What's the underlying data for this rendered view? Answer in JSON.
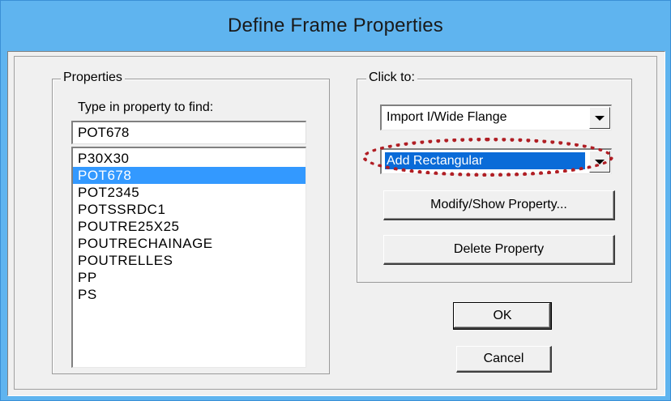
{
  "window": {
    "title": "Define Frame Properties"
  },
  "properties": {
    "group_label": "Properties",
    "find_label": "Type in property to find:",
    "find_value": "POT678",
    "items": [
      "P30X30",
      "POT678",
      "POT2345",
      "POTSSRDC1",
      "POUTRE25X25",
      "POUTRECHAINAGE",
      "POUTRELLES",
      "PP",
      "PS"
    ],
    "selected_index": 1
  },
  "click_to": {
    "group_label": "Click to:",
    "import_combo": "Import I/Wide Flange",
    "add_combo": "Add Rectangular",
    "modify_button": "Modify/Show Property...",
    "delete_button": "Delete Property"
  },
  "buttons": {
    "ok": "OK",
    "cancel": "Cancel"
  },
  "colors": {
    "titlebar": "#5fb4ef",
    "selection": "#3399ff",
    "annotation": "#b01e24"
  }
}
